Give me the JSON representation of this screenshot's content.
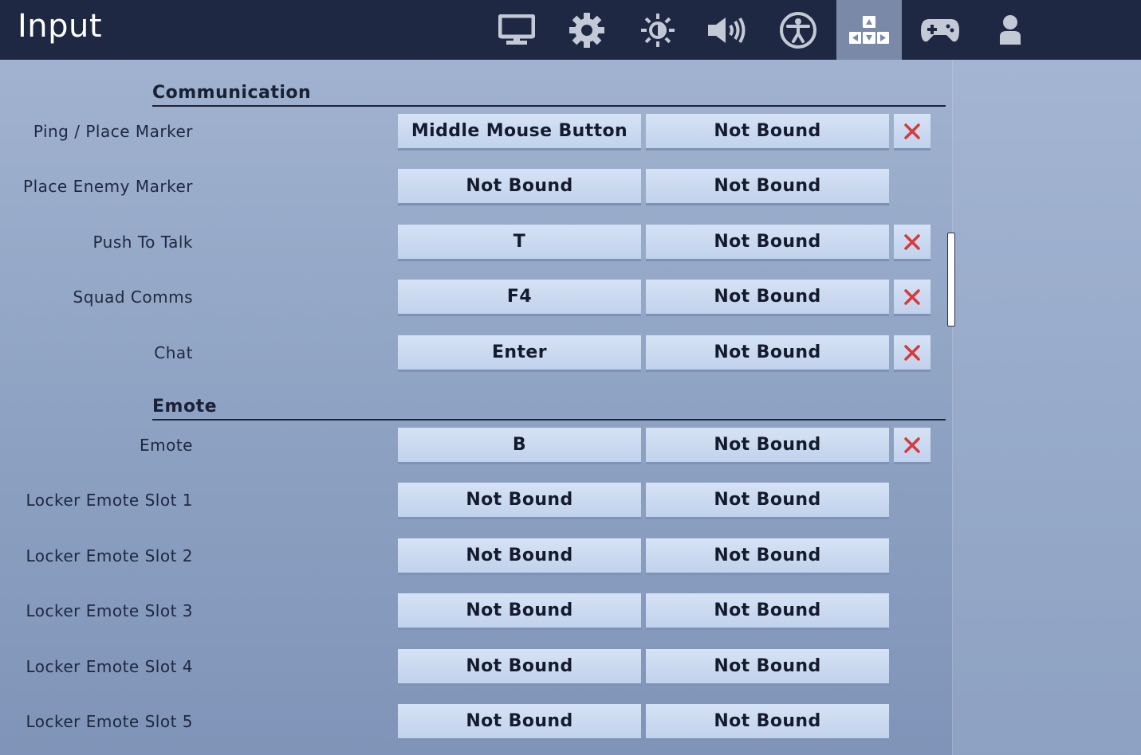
{
  "header": {
    "title": "Input",
    "tabs": [
      {
        "name": "display",
        "icon": "monitor-icon",
        "active": false
      },
      {
        "name": "game",
        "icon": "gear-icon",
        "active": false
      },
      {
        "name": "brightness",
        "icon": "brightness-icon",
        "active": false
      },
      {
        "name": "audio",
        "icon": "speaker-icon",
        "active": false
      },
      {
        "name": "accessibility",
        "icon": "accessibility-icon",
        "active": false
      },
      {
        "name": "input",
        "icon": "keyboard-keys-icon",
        "active": true
      },
      {
        "name": "controller",
        "icon": "gamepad-icon",
        "active": false
      },
      {
        "name": "account",
        "icon": "person-icon",
        "active": false
      }
    ]
  },
  "sections": [
    {
      "title": "Communication",
      "rows": [
        {
          "label": "Ping / Place Marker",
          "primary": "Middle Mouse Button",
          "secondary": "Not Bound",
          "clearable": true
        },
        {
          "label": "Place Enemy Marker",
          "primary": "Not Bound",
          "secondary": "Not Bound",
          "clearable": false
        },
        {
          "label": "Push To Talk",
          "primary": "T",
          "secondary": "Not Bound",
          "clearable": true
        },
        {
          "label": "Squad Comms",
          "primary": "F4",
          "secondary": "Not Bound",
          "clearable": true
        },
        {
          "label": "Chat",
          "primary": "Enter",
          "secondary": "Not Bound",
          "clearable": true
        }
      ]
    },
    {
      "title": "Emote",
      "rows": [
        {
          "label": "Emote",
          "primary": "B",
          "secondary": "Not Bound",
          "clearable": true
        },
        {
          "label": "Locker Emote Slot 1",
          "primary": "Not Bound",
          "secondary": "Not Bound",
          "clearable": false
        },
        {
          "label": "Locker Emote Slot 2",
          "primary": "Not Bound",
          "secondary": "Not Bound",
          "clearable": false
        },
        {
          "label": "Locker Emote Slot 3",
          "primary": "Not Bound",
          "secondary": "Not Bound",
          "clearable": false
        },
        {
          "label": "Locker Emote Slot 4",
          "primary": "Not Bound",
          "secondary": "Not Bound",
          "clearable": false
        },
        {
          "label": "Locker Emote Slot 5",
          "primary": "Not Bound",
          "secondary": "Not Bound",
          "clearable": false
        }
      ]
    }
  ],
  "colors": {
    "topbar": "#1e2843",
    "active_tab": "#7b89a9",
    "clear_x": "#d63a3a"
  }
}
